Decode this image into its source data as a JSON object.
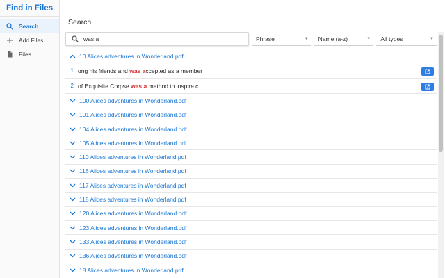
{
  "app": {
    "title": "Find in Files"
  },
  "sidebar": {
    "items": [
      {
        "label": "Search",
        "icon": "search-icon",
        "active": true
      },
      {
        "label": "Add Files",
        "icon": "plus-icon",
        "active": false
      },
      {
        "label": "Files",
        "icon": "file-icon",
        "active": false
      }
    ]
  },
  "main": {
    "title": "Search",
    "search": {
      "value": "was a"
    },
    "filters": {
      "mode": "Phrase",
      "sort": "Name (a-z)",
      "type": "All types"
    }
  },
  "results": {
    "expanded": {
      "name": "10 Alices adventures in Wonderland.pdf",
      "matches": [
        {
          "num": "1",
          "before": "ong his friends and ",
          "hit": "was a",
          "after": "ccepted as a member"
        },
        {
          "num": "2",
          "before": "of Exquisite Corpse ",
          "hit": "was a",
          "after": " method to inspire c"
        }
      ]
    },
    "files": [
      "100 Alices adventures in Wonderland.pdf",
      "101 Alices adventures in Wonderland.pdf",
      "104 Alices adventures in Wonderland.pdf",
      "105 Alices adventures in Wonderland.pdf",
      "110 Alices adventures in Wonderland.pdf",
      "116 Alices adventures in Wonderland.pdf",
      "117 Alices adventures in Wonderland.pdf",
      "118 Alices adventures in Wonderland.pdf",
      "120 Alices adventures in Wonderland.pdf",
      "123 Alices adventures in Wonderland.pdf",
      "133 Alices adventures in Wonderland.pdf",
      "136 Alices adventures in Wonderland.pdf",
      "18 Alices adventures in Wonderland.pdf"
    ]
  },
  "colors": {
    "accent": "#1976d2",
    "highlight": "#d32f2f",
    "button": "#2f7de1"
  }
}
